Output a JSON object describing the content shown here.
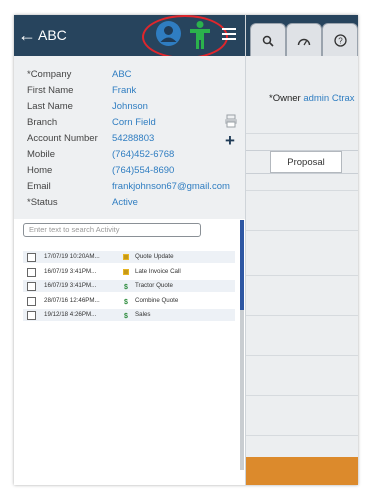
{
  "header": {
    "title": "ABC"
  },
  "details": [
    {
      "label": "*Company",
      "value": "ABC"
    },
    {
      "label": "First Name",
      "value": "Frank"
    },
    {
      "label": "Last Name",
      "value": "Johnson"
    },
    {
      "label": "Branch",
      "value": "Corn Field"
    },
    {
      "label": "Account Number",
      "value": "54288803"
    },
    {
      "label": "Mobile",
      "value": "(764)452-6768"
    },
    {
      "label": "Home",
      "value": "(764)554-8690"
    },
    {
      "label": "Email",
      "value": "frankjohnson67@gmail.com"
    },
    {
      "label": "*Status",
      "value": "Active"
    }
  ],
  "search": {
    "placeholder": "Enter text to search Activity"
  },
  "activities": [
    {
      "date": "17/07/19 10:20AM...",
      "icon": "note-icon",
      "name": "Quote Update"
    },
    {
      "date": "16/07/19 3:41PM...",
      "icon": "note-icon",
      "name": "Late Invoice Call"
    },
    {
      "date": "16/07/19 3:41PM...",
      "icon": "dollar-icon",
      "name": "Tractor Quote"
    },
    {
      "date": "28/07/16 12:46PM...",
      "icon": "dollar-icon",
      "name": "Combine Quote"
    },
    {
      "date": "19/12/18 4:26PM...",
      "icon": "dollar-icon",
      "name": "Sales"
    }
  ],
  "background": {
    "owner_label": "*Owner",
    "owner_value": "admin Ctrax",
    "stage": "Proposal"
  },
  "colors": {
    "header": "#27445d",
    "link": "#2f7dc1",
    "highlight": "#e0262c",
    "person_green": "#2bb24c",
    "orange_bar": "#dc8a2c"
  }
}
